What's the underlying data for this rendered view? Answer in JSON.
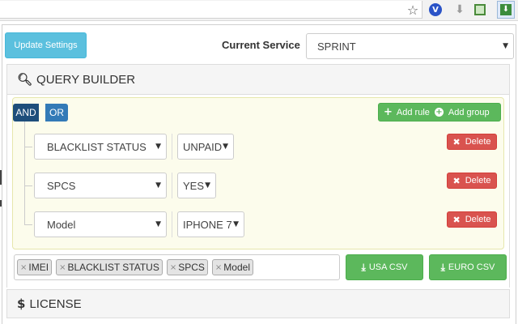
{
  "header": {
    "update_label": "Update Settings",
    "service_label": "Current Service",
    "service_value": "SPRINT"
  },
  "query_builder": {
    "title": "QUERY BUILDER",
    "conditions": [
      "AND",
      "OR"
    ],
    "add_rule_label": "Add rule",
    "add_group_label": "Add group",
    "rules": [
      {
        "field": "BLACKLIST STATUS",
        "value": "UNPAID",
        "delete_label": "Delete"
      },
      {
        "field": "SPCS",
        "value": "YES",
        "delete_label": "Delete"
      },
      {
        "field": "Model",
        "value": "IPHONE 7",
        "delete_label": "Delete"
      }
    ]
  },
  "export": {
    "tags": [
      "IMEI",
      "BLACKLIST STATUS",
      "SPCS",
      "Model"
    ],
    "usa_label": "USA CSV",
    "euro_label": "EURO CSV"
  },
  "license": {
    "title": "LICENSE"
  },
  "icons": {
    "star": "bookmark-star-icon",
    "search": "search-icon",
    "dollar": "dollar-icon",
    "download": "download-icon"
  },
  "colors": {
    "info": "#5bc0de",
    "primary": "#337ab7",
    "primary_dark": "#1e4e7b",
    "success": "#5cb85c",
    "danger": "#d9534f",
    "group_bg": "#fcfcec"
  }
}
